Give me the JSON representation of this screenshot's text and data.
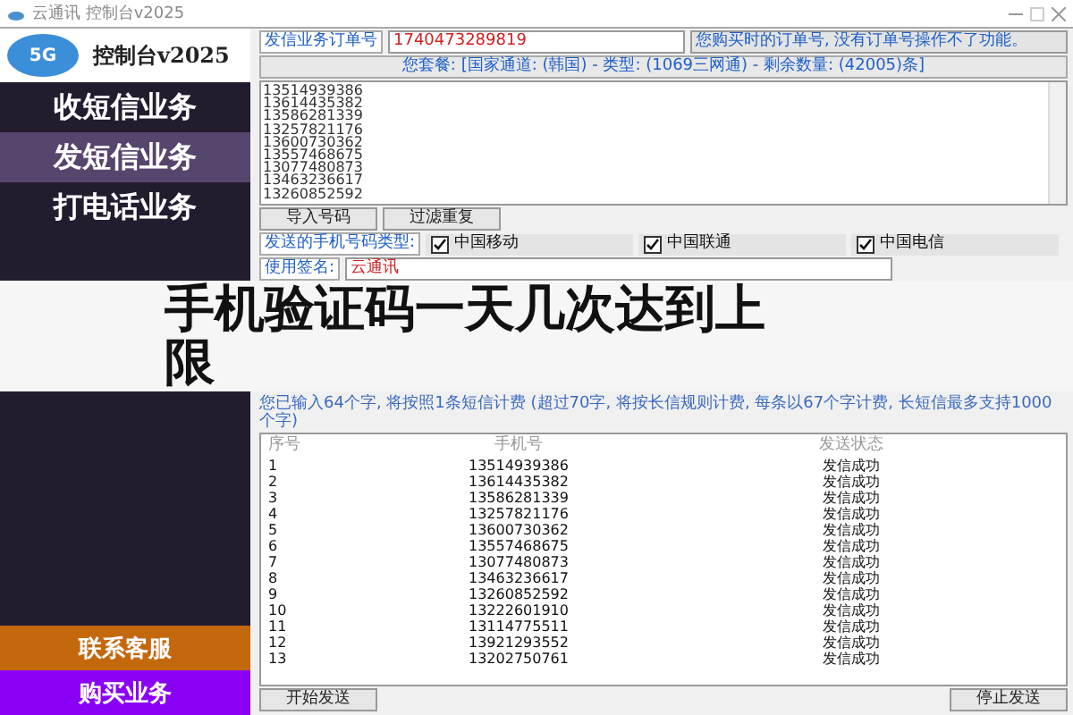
{
  "window": {
    "title": "云通讯 控制台v2025"
  },
  "brand": {
    "badge": "5G",
    "title": "控制台v2025"
  },
  "sidebar": {
    "items": [
      {
        "label": "收短信业务",
        "selected": false
      },
      {
        "label": "发短信业务",
        "selected": true
      },
      {
        "label": "打电话业务",
        "selected": false
      }
    ],
    "bottom": [
      {
        "label": "联系客服",
        "color": "#c4680e"
      },
      {
        "label": "购买业务",
        "color": "#8a00f5"
      }
    ]
  },
  "order": {
    "label": "发信业务订单号",
    "value": "1740473289819",
    "hint": "您购买时的订单号, 没有订单号操作不了功能。"
  },
  "package": "您套餐: [国家通道: (韩国) - 类型: (1069三网通) - 剩余数量: (42005)条]",
  "numbers": [
    "13514939386",
    "13614435382",
    "13586281339",
    "13257821176",
    "13600730362",
    "13557468675",
    "13077480873",
    "13463236617",
    "13260852592"
  ],
  "number_buttons": [
    "导入号码",
    "过滤重复"
  ],
  "carrier_label": "发送的手机号码类型:",
  "carriers": [
    {
      "label": "中国移动",
      "checked": true
    },
    {
      "label": "中国联通",
      "checked": true
    },
    {
      "label": "中国电信",
      "checked": true
    }
  ],
  "signature": {
    "label": "使用签名:",
    "value": "云通讯"
  },
  "count_hint": "您已输入64个字, 将按照1条短信计费 (超过70字, 将按长信规则计费, 每条以67个字计费, 长短信最多支持1000个字)",
  "table": {
    "columns": [
      "序号",
      "手机号",
      "发送状态"
    ],
    "rows": [
      [
        "1",
        "13514939386",
        "发信成功"
      ],
      [
        "2",
        "13614435382",
        "发信成功"
      ],
      [
        "3",
        "13586281339",
        "发信成功"
      ],
      [
        "4",
        "13257821176",
        "发信成功"
      ],
      [
        "5",
        "13600730362",
        "发信成功"
      ],
      [
        "6",
        "13557468675",
        "发信成功"
      ],
      [
        "7",
        "13077480873",
        "发信成功"
      ],
      [
        "8",
        "13463236617",
        "发信成功"
      ],
      [
        "9",
        "13260852592",
        "发信成功"
      ],
      [
        "10",
        "13222601910",
        "发信成功"
      ],
      [
        "11",
        "13114775511",
        "发信成功"
      ],
      [
        "12",
        "13921293552",
        "发信成功"
      ],
      [
        "13",
        "13202750761",
        "发信成功"
      ]
    ]
  },
  "actions": [
    "开始发送",
    "停止发送"
  ],
  "headline": "手机验证码一天几次达到上限"
}
